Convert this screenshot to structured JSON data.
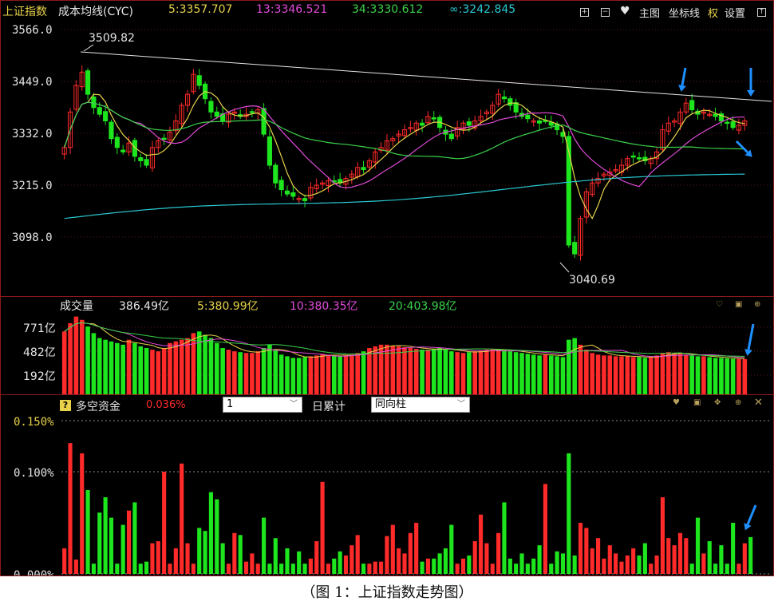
{
  "colors": {
    "up": "#ff2a2a",
    "down": "#1ee61e",
    "ma5": "#e6d24a",
    "ma13": "#e04ad8",
    "ma34": "#3bd24a",
    "ma_inf": "#2ac8d2",
    "label": "#e6e6e6",
    "arrow": "#1e90ff",
    "trend": "#e6e6e6"
  },
  "price_header": {
    "title": "上证指数",
    "indicator": "成本均线(CYC)",
    "ma5": "5:3357.707",
    "ma13": "13:3346.521",
    "ma34": "34:3330.612",
    "ma_inf": "∞:3242.845"
  },
  "toolbar": {
    "plus_icon": "plus-icon",
    "minus_icon": "minus-icon",
    "heart_icon": "heart-icon",
    "main_chart": "主图",
    "axis_line": "坐标线",
    "rights": "权",
    "settings": "设置",
    "export_icon": "export-icon"
  },
  "price_axis_labels": [
    "3566.0",
    "3449.0",
    "3332.0",
    "3215.0",
    "3098.0"
  ],
  "annotations": {
    "high": "3509.82",
    "low": "3040.69"
  },
  "volume_header": {
    "title": "成交量",
    "value": "386.49亿",
    "ma5": "5:380.99亿",
    "ma10": "10:380.35亿",
    "ma20": "20:403.98亿"
  },
  "volume_axis_labels": [
    "771亿",
    "482亿",
    "192亿"
  ],
  "flow_header": {
    "help_icon": "?",
    "title": "多空资金",
    "value": "0.036%",
    "period_select": "1",
    "accumulate_label": "日累计",
    "mode_select": "同向柱"
  },
  "flow_axis_labels": [
    "0.150%",
    "0.100%",
    "0.000%"
  ],
  "caption": "（图 1：上证指数走势图）",
  "chart_data": [
    {
      "type": "candlestick",
      "title": "上证指数",
      "ylim": [
        3040.69,
        3566.0
      ],
      "y_ticks": [
        3566.0,
        3449.0,
        3332.0,
        3215.0,
        3098.0
      ],
      "series_names": [
        "5",
        "13",
        "34",
        "∞"
      ],
      "last_values": {
        "ma5": 3357.707,
        "ma13": 3346.521,
        "ma34": 3330.612,
        "ma_inf": 3242.845
      },
      "annotations": [
        {
          "text": "3509.82",
          "value": 3509.82
        },
        {
          "text": "3040.69",
          "value": 3040.69
        }
      ],
      "closes": [
        3300,
        3380,
        3440,
        3470,
        3420,
        3390,
        3375,
        3360,
        3320,
        3300,
        3290,
        3310,
        3280,
        3270,
        3260,
        3300,
        3315,
        3320,
        3335,
        3360,
        3395,
        3420,
        3465,
        3440,
        3410,
        3380,
        3370,
        3360,
        3375,
        3380,
        3370,
        3375,
        3380,
        3385,
        3330,
        3260,
        3220,
        3205,
        3195,
        3190,
        3185,
        3180,
        3210,
        3215,
        3220,
        3225,
        3222,
        3220,
        3230,
        3240,
        3255,
        3250,
        3270,
        3290,
        3300,
        3315,
        3320,
        3330,
        3340,
        3345,
        3355,
        3350,
        3370,
        3365,
        3345,
        3330,
        3320,
        3345,
        3355,
        3350,
        3360,
        3370,
        3380,
        3395,
        3420,
        3410,
        3395,
        3380,
        3370,
        3365,
        3360,
        3355,
        3360,
        3350,
        3340,
        3325,
        3080,
        3060,
        3140,
        3200,
        3220,
        3230,
        3240,
        3245,
        3250,
        3260,
        3275,
        3280,
        3275,
        3270,
        3275,
        3290,
        3340,
        3355,
        3360,
        3380,
        3400,
        3385,
        3375,
        3380,
        3375,
        3370,
        3360,
        3355,
        3345,
        3350,
        3360
      ]
    },
    {
      "type": "bar",
      "title": "成交量",
      "unit": "亿",
      "y_ticks": [
        771,
        482,
        192
      ],
      "last_values": {
        "volume": 386.49,
        "ma5": 380.99,
        "ma10": 380.35,
        "ma20": 403.98
      },
      "values": [
        720,
        820,
        900,
        860,
        780,
        700,
        640,
        620,
        600,
        580,
        560,
        620,
        580,
        540,
        520,
        500,
        480,
        520,
        580,
        600,
        620,
        640,
        700,
        720,
        680,
        640,
        580,
        520,
        500,
        480,
        470,
        460,
        460,
        480,
        520,
        560,
        500,
        440,
        420,
        400,
        400,
        410,
        420,
        430,
        450,
        440,
        430,
        420,
        430,
        440,
        460,
        480,
        520,
        540,
        560,
        560,
        550,
        540,
        530,
        520,
        510,
        500,
        500,
        510,
        520,
        500,
        480,
        470,
        460,
        470,
        480,
        490,
        500,
        510,
        500,
        490,
        480,
        470,
        460,
        450,
        440,
        430,
        440,
        430,
        420,
        410,
        620,
        640,
        560,
        500,
        460,
        440,
        430,
        430,
        420,
        420,
        420,
        410,
        410,
        400,
        410,
        430,
        460,
        470,
        460,
        450,
        440,
        430,
        420,
        420,
        410,
        400,
        400,
        395,
        390,
        388,
        386
      ]
    },
    {
      "type": "bar",
      "title": "多空资金",
      "unit": "%",
      "ylim": [
        0,
        0.15
      ],
      "y_ticks": [
        0.15,
        0.1,
        0.0
      ],
      "last_value": 0.036,
      "values": [
        0.025,
        0.128,
        0.014,
        0.118,
        0.082,
        0.01,
        0.06,
        0.075,
        0.055,
        0.01,
        0.048,
        0.062,
        0.07,
        0.01,
        0.012,
        0.03,
        0.032,
        0.1,
        0.01,
        0.025,
        0.108,
        0.03,
        0.01,
        0.045,
        0.042,
        0.08,
        0.073,
        0.03,
        0.01,
        0.04,
        0.038,
        0.012,
        0.02,
        0.01,
        0.055,
        0.01,
        0.035,
        0.01,
        0.025,
        0.01,
        0.022,
        0.01,
        0.015,
        0.032,
        0.09,
        0.01,
        0.015,
        0.022,
        0.018,
        0.028,
        0.038,
        0.01,
        0.01,
        0.012,
        0.012,
        0.037,
        0.048,
        0.025,
        0.02,
        0.04,
        0.05,
        0.012,
        0.015,
        0.015,
        0.02,
        0.025,
        0.048,
        0.01,
        0.015,
        0.018,
        0.032,
        0.058,
        0.03,
        0.01,
        0.04,
        0.07,
        0.015,
        0.01,
        0.02,
        0.01,
        0.015,
        0.028,
        0.088,
        0.01,
        0.022,
        0.02,
        0.118,
        0.018,
        0.05,
        0.045,
        0.025,
        0.035,
        0.015,
        0.028,
        0.02,
        0.012,
        0.018,
        0.025,
        0.018,
        0.03,
        0.01,
        0.018,
        0.075,
        0.035,
        0.028,
        0.04,
        0.035,
        0.01,
        0.055,
        0.02,
        0.032,
        0.01,
        0.028,
        0.01,
        0.05,
        0.01,
        0.03,
        0.036
      ]
    }
  ]
}
